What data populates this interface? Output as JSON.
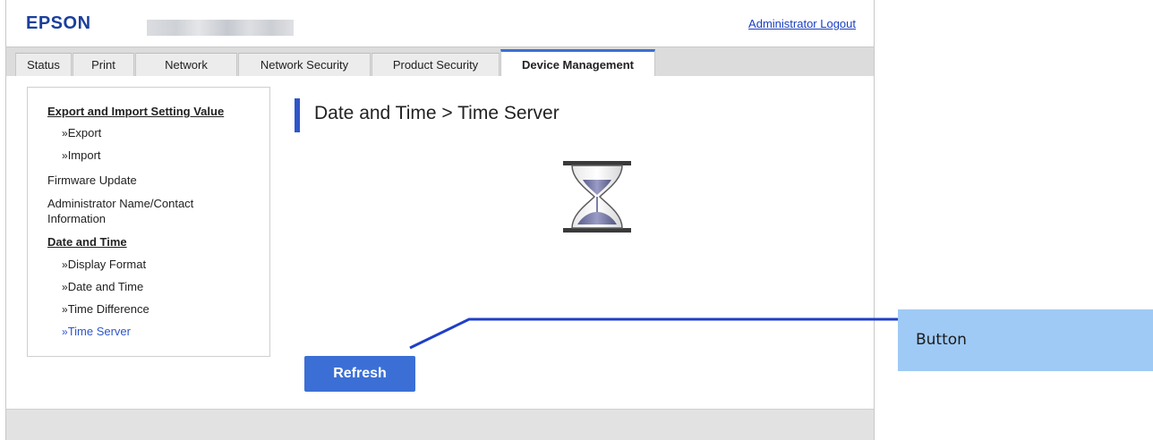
{
  "header": {
    "logo": "EPSON",
    "logout": "Administrator Logout"
  },
  "tabs": [
    {
      "label": "Status"
    },
    {
      "label": "Print"
    },
    {
      "label": "Network"
    },
    {
      "label": "Network Security"
    },
    {
      "label": "Product Security"
    },
    {
      "label": "Device Management",
      "active": true
    }
  ],
  "sidebar": {
    "items": [
      {
        "label": "Export and Import Setting Value"
      },
      {
        "label": "Export"
      },
      {
        "label": "Import"
      },
      {
        "label": "Firmware Update"
      },
      {
        "label": "Administrator Name/Contact"
      },
      {
        "label": "Information"
      },
      {
        "label": "Date and Time"
      },
      {
        "label": "Display Format"
      },
      {
        "label": "Date and Time"
      },
      {
        "label": "Time Difference"
      },
      {
        "label": "Time Server",
        "current": true
      }
    ],
    "link_prefix": "»"
  },
  "main": {
    "title": "Date and Time > Time Server",
    "refresh_label": "Refresh"
  },
  "callout": {
    "label": "Button"
  },
  "colors": {
    "brand": "#1a3f9c",
    "accent": "#3b6fd6",
    "link_current": "#2f56c8",
    "callout_bg": "#9fcaf5",
    "callout_line": "#1f3fc8"
  },
  "icons": {
    "loading": "hourglass-icon"
  }
}
